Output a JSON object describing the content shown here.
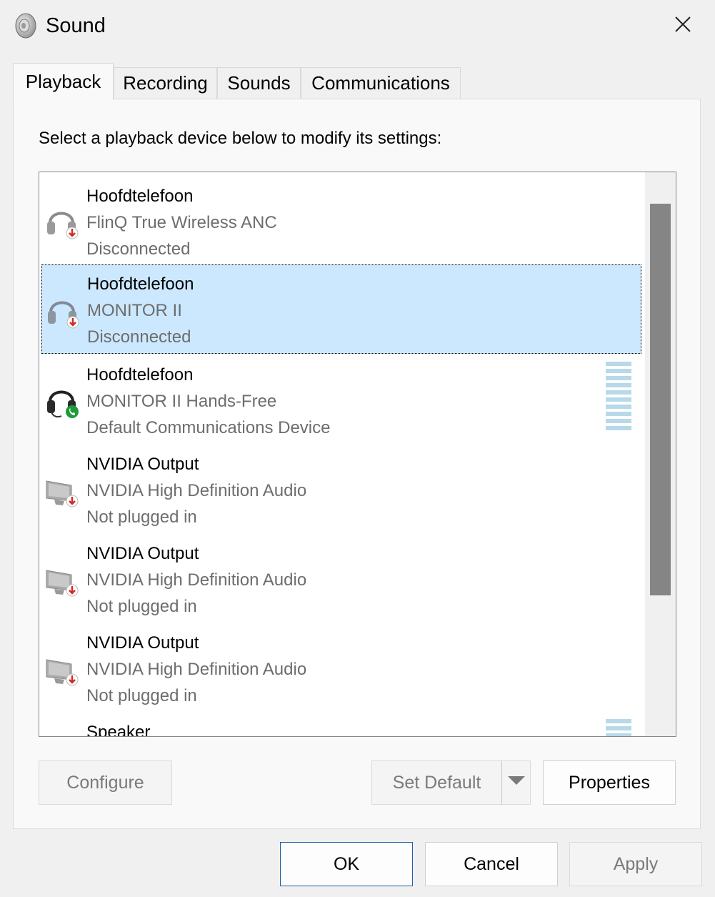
{
  "window": {
    "title": "Sound",
    "title_icon": "speaker-icon",
    "close_icon": "close-icon"
  },
  "tabs": [
    {
      "label": "Playback",
      "active": true
    },
    {
      "label": "Recording",
      "active": false
    },
    {
      "label": "Sounds",
      "active": false
    },
    {
      "label": "Communications",
      "active": false
    }
  ],
  "instruction": "Select a playback device below to modify its settings:",
  "devices": [
    {
      "name": "Hoofdtelefoon",
      "description": "FlinQ True Wireless ANC",
      "status": "Disconnected",
      "icon": "headphones-disconnected-icon",
      "selected": false
    },
    {
      "name": "Hoofdtelefoon",
      "description": "MONITOR II",
      "status": "Disconnected",
      "icon": "headphones-disconnected-icon",
      "selected": true
    },
    {
      "name": "Hoofdtelefoon",
      "description": "MONITOR II Hands-Free",
      "status": "Default Communications Device",
      "icon": "headset-communications-icon",
      "selected": false
    },
    {
      "name": "NVIDIA Output",
      "description": "NVIDIA High Definition Audio",
      "status": "Not plugged in",
      "icon": "monitor-unplugged-icon",
      "selected": false
    },
    {
      "name": "NVIDIA Output",
      "description": "NVIDIA High Definition Audio",
      "status": "Not plugged in",
      "icon": "monitor-unplugged-icon",
      "selected": false
    },
    {
      "name": "NVIDIA Output",
      "description": "NVIDIA High Definition Audio",
      "status": "Not plugged in",
      "icon": "monitor-unplugged-icon",
      "selected": false
    },
    {
      "name": "Speaker",
      "description": "",
      "status": "",
      "icon": "speaker-icon",
      "selected": false
    }
  ],
  "buttons": {
    "configure": "Configure",
    "set_default": "Set Default",
    "properties": "Properties",
    "ok": "OK",
    "cancel": "Cancel",
    "apply": "Apply"
  },
  "colors": {
    "selection_bg": "#cce8ff",
    "meter": "#b7d9ea",
    "disconnect_badge": "#d42a2a",
    "phone_badge": "#1f9a3a"
  }
}
